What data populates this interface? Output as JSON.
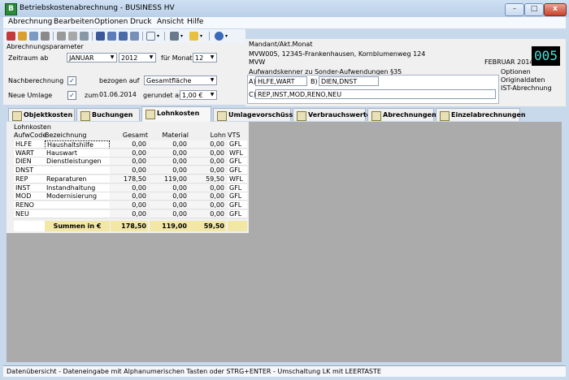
{
  "window": {
    "title": "Betriebskostenabrechnung - BUSINESS HV",
    "buttons": {
      "minimize": "–",
      "maximize": "□",
      "close": "x"
    }
  },
  "menu": [
    "Abrechnung",
    "Bearbeiten",
    "Optionen",
    "Druck",
    "Ansicht",
    "Hilfe"
  ],
  "toolbar": {
    "icons": [
      "new-doc-icon",
      "open-icon",
      "undo-icon",
      "stop-icon",
      "cut-icon",
      "copy-icon",
      "sort-icon",
      "copy-doc-icon",
      "paste-icon",
      "view-icon",
      "print-icon",
      "folder-icon",
      "help-icon"
    ]
  },
  "params": {
    "group_label": "Abrechnungsparameter",
    "zeitraum_label": "Zeitraum ab",
    "month": "JANUAR",
    "year": "2012",
    "fuer_monate_label": "für Monate",
    "months_count": "12",
    "nachberechnung_label": "Nachberechnung",
    "nachberechnung_checked": "✓",
    "bezogen_label": "bezogen auf",
    "bezogen_value": "Gesamtfläche",
    "neue_umlage_label": "Neue Umlage",
    "neue_umlage_checked": "✓",
    "zum_label": "zum",
    "zum_date": "01.06.2014",
    "gerundet_label": "gerundet auf",
    "gerundet_value": "1,00 €"
  },
  "mandant": {
    "label": "Mandant/Akt.Monat",
    "line1": "MVW005, 12345-Frankenhausen, Kornblumenweg 124",
    "line2": "MVW",
    "month": "FEBRUAR 2014",
    "badge": "005"
  },
  "aufwand": {
    "label": "Aufwandskenner zu Sonder-Aufwendungen §35",
    "a_label": "A)",
    "a_value": "HLFE,WART",
    "b_label": "B)",
    "b_value": "DIEN,DNST",
    "c_label": "C)",
    "c_value": "REP,INST,MOD,RENO,NEU"
  },
  "optionen": {
    "label": "Optionen",
    "line1": "Originaldaten",
    "line2": "IST-Abrechnung"
  },
  "tabs": [
    "Objektkosten",
    "Buchungen",
    "Lohnkosten",
    "Umlagevorschüsse",
    "Verbrauchswerte",
    "Abrechnungen",
    "Einzelabrechnungen"
  ],
  "grid": {
    "caption": "Lohnkosten",
    "headers": [
      "AufwCode",
      "Bezeichnung",
      "Gesamt",
      "Material",
      "Lohn",
      "VTS"
    ],
    "rows": [
      [
        "HLFE",
        "Haushaltshilfe",
        "0,00",
        "0,00",
        "0,00",
        "GFL"
      ],
      [
        "WART",
        "Hauswart",
        "0,00",
        "0,00",
        "0,00",
        "WFL"
      ],
      [
        "DIEN",
        "Dienstleistungen",
        "0,00",
        "0,00",
        "0,00",
        "GFL"
      ],
      [
        "DNST",
        "",
        "0,00",
        "0,00",
        "0,00",
        "GFL"
      ],
      [
        "REP",
        "Reparaturen",
        "178,50",
        "119,00",
        "59,50",
        "WFL"
      ],
      [
        "INST",
        "Instandhaltung",
        "0,00",
        "0,00",
        "0,00",
        "GFL"
      ],
      [
        "MOD",
        "Modernisierung",
        "0,00",
        "0,00",
        "0,00",
        "GFL"
      ],
      [
        "RENO",
        "",
        "0,00",
        "0,00",
        "0,00",
        "GFL"
      ],
      [
        "NEU",
        "",
        "0,00",
        "0,00",
        "0,00",
        "GFL"
      ]
    ],
    "summary": [
      "",
      "Summen in €",
      "178,50",
      "119,00",
      "59,50",
      ""
    ]
  },
  "statusbar": "Datenübersicht - Dateneingabe mit Alphanumerischen Tasten oder STRG+ENTER - Umschaltung LK mit LEERTASTE"
}
